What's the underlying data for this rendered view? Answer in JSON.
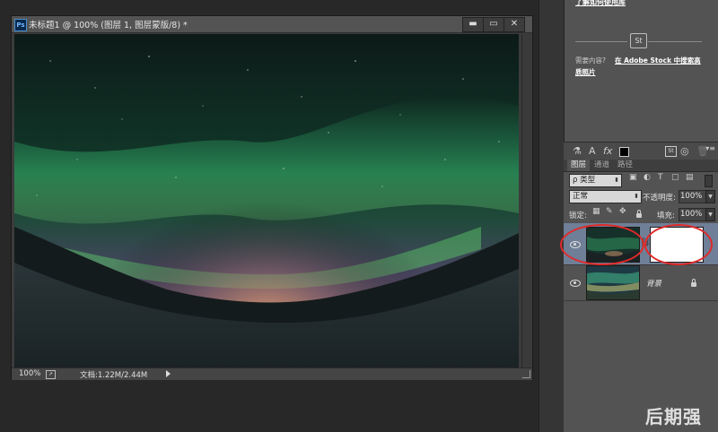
{
  "document": {
    "title": "未标题1 @ 100% (图层 1, 图层蒙版/8) *",
    "ps_icon_text": "Ps",
    "zoom": "100%",
    "doc_info": "文档:1.22M/2.44M",
    "window_buttons": {
      "minimize": "▬",
      "maximize": "▭",
      "close": "✕"
    }
  },
  "learn_panel": {
    "top_link": "了解如何使用库",
    "divider_icon_text": "St",
    "need_content_label": "需要内容?",
    "stock_link_line1": "在 Adobe Stock 中搜索高",
    "stock_link_line2": "质照片"
  },
  "layers_panel": {
    "toolbar_icons": [
      "paint-icon",
      "text-A-icon",
      "fx-icon",
      "swatch-icon",
      "stock-icon",
      "view-icon",
      "trash-icon"
    ],
    "tabs": [
      {
        "label": "图层",
        "active": true
      },
      {
        "label": "通道",
        "active": false
      },
      {
        "label": "路径",
        "active": false
      }
    ],
    "filter": {
      "label": "ρ 类型"
    },
    "blend_mode": "正常",
    "opacity_label": "不透明度:",
    "opacity_value": "100%",
    "lock_label": "锁定:",
    "fill_label": "填充:",
    "fill_value": "100%",
    "layers": [
      {
        "name": "",
        "has_mask": true,
        "selected": true,
        "visible": true
      },
      {
        "name": "背景",
        "has_mask": false,
        "selected": false,
        "visible": true,
        "locked": true
      }
    ]
  },
  "watermark": "后期强",
  "colors": {
    "panel_bg": "#535353",
    "workspace_bg": "#282828",
    "annotation_red": "#e02a2a",
    "selected_layer": "#6f7f97"
  }
}
